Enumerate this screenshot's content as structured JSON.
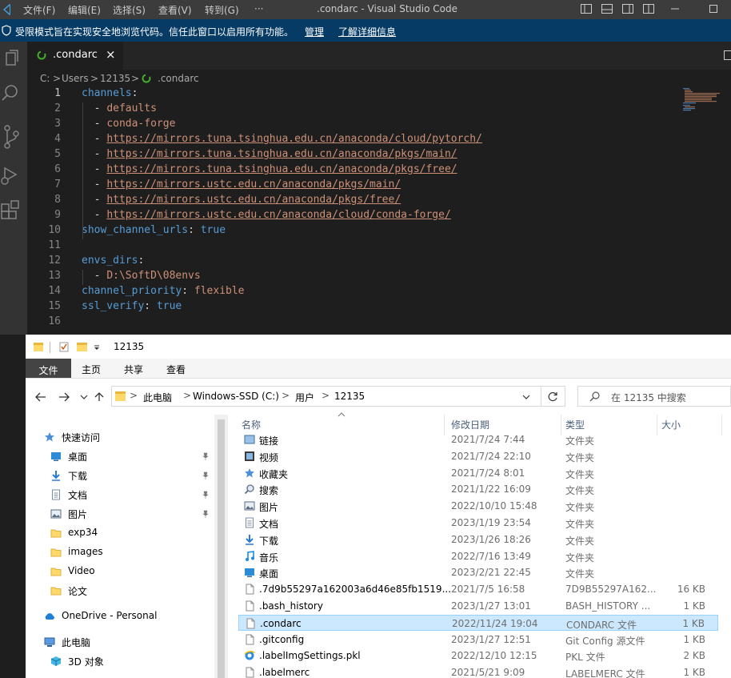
{
  "titlebar": {
    "menus": [
      "文件(F)",
      "编辑(E)",
      "选择(S)",
      "查看(V)",
      "转到(G)",
      "···"
    ],
    "title": ".condarc - Visual Studio Code"
  },
  "banner": {
    "text": "受限模式旨在实现安全地浏览代码。信任此窗口以启用所有功能。",
    "manage": "管理",
    "learn_more": "了解详细信息"
  },
  "tab": {
    "label": ".condarc",
    "close": "×"
  },
  "breadcrumb": [
    "C:",
    ">",
    "Users",
    ">",
    "12135",
    ">",
    ".condarc"
  ],
  "code": {
    "lines": [
      [
        [
          "key",
          "channels"
        ],
        [
          "dash",
          ":"
        ]
      ],
      [
        [
          "dash",
          "  - "
        ],
        [
          "str",
          "defaults"
        ]
      ],
      [
        [
          "dash",
          "  - "
        ],
        [
          "str",
          "conda-forge"
        ]
      ],
      [
        [
          "dash",
          "  - "
        ],
        [
          "url",
          "https://mirrors.tuna.tsinghua.edu.cn/anaconda/cloud/pytorch/"
        ]
      ],
      [
        [
          "dash",
          "  - "
        ],
        [
          "url",
          "https://mirrors.tuna.tsinghua.edu.cn/anaconda/pkgs/main/"
        ]
      ],
      [
        [
          "dash",
          "  - "
        ],
        [
          "url",
          "https://mirrors.tuna.tsinghua.edu.cn/anaconda/pkgs/free/"
        ]
      ],
      [
        [
          "dash",
          "  - "
        ],
        [
          "url",
          "https://mirrors.ustc.edu.cn/anaconda/pkgs/main/"
        ]
      ],
      [
        [
          "dash",
          "  - "
        ],
        [
          "url",
          "https://mirrors.ustc.edu.cn/anaconda/pkgs/free/"
        ]
      ],
      [
        [
          "dash",
          "  - "
        ],
        [
          "url",
          "https://mirrors.ustc.edu.cn/anaconda/cloud/conda-forge/"
        ]
      ],
      [
        [
          "key",
          "show_channel_urls"
        ],
        [
          "dash",
          ": "
        ],
        [
          "bool",
          "true"
        ]
      ],
      [],
      [
        [
          "key",
          "envs_dirs"
        ],
        [
          "dash",
          ":"
        ]
      ],
      [
        [
          "dash",
          "  - "
        ],
        [
          "str",
          "D:\\SoftD\\08envs"
        ]
      ],
      [
        [
          "key",
          "channel_priority"
        ],
        [
          "dash",
          ": "
        ],
        [
          "str",
          "flexible"
        ]
      ],
      [
        [
          "key",
          "ssl_verify"
        ],
        [
          "dash",
          ": "
        ],
        [
          "bool",
          "true"
        ]
      ],
      []
    ]
  },
  "explorer": {
    "qa_title": "12135",
    "ribbon": [
      "文件",
      "主页",
      "共享",
      "查看"
    ],
    "address": [
      "此电脑",
      ">",
      "Windows-SSD (C:)",
      ">",
      "用户",
      ">",
      "12135"
    ],
    "search_placeholder": "在 12135 中搜索",
    "nav": [
      {
        "label": "快速访问",
        "icon": "star",
        "indent": 0,
        "pin": false
      },
      {
        "label": "桌面",
        "icon": "desktop",
        "indent": 1,
        "pin": true
      },
      {
        "label": "下载",
        "icon": "download",
        "indent": 1,
        "pin": true
      },
      {
        "label": "文档",
        "icon": "doc",
        "indent": 1,
        "pin": true
      },
      {
        "label": "图片",
        "icon": "pic",
        "indent": 1,
        "pin": true
      },
      {
        "label": "exp34",
        "icon": "folder",
        "indent": 1,
        "pin": false
      },
      {
        "label": "images",
        "icon": "folder",
        "indent": 1,
        "pin": false
      },
      {
        "label": "Video",
        "icon": "folder",
        "indent": 1,
        "pin": false
      },
      {
        "label": "论文",
        "icon": "folder",
        "indent": 1,
        "pin": false
      },
      {
        "label": "OneDrive - Personal",
        "icon": "cloud",
        "indent": 0,
        "pin": false
      },
      {
        "label": "此电脑",
        "icon": "pc",
        "indent": 0,
        "pin": false
      },
      {
        "label": "3D 对象",
        "icon": "cube",
        "indent": 1,
        "pin": false
      }
    ],
    "columns": [
      "名称",
      "修改日期",
      "类型",
      "大小"
    ],
    "rows": [
      {
        "name": "链接",
        "date": "2021/7/24 7:44",
        "type": "文件夹",
        "size": "",
        "icon": "link"
      },
      {
        "name": "视频",
        "date": "2021/7/24 22:10",
        "type": "文件夹",
        "size": "",
        "icon": "video"
      },
      {
        "name": "收藏夹",
        "date": "2021/7/24 8:01",
        "type": "文件夹",
        "size": "",
        "icon": "star"
      },
      {
        "name": "搜索",
        "date": "2021/1/22 16:09",
        "type": "文件夹",
        "size": "",
        "icon": "search"
      },
      {
        "name": "图片",
        "date": "2022/10/10 15:48",
        "type": "文件夹",
        "size": "",
        "icon": "pic"
      },
      {
        "name": "文档",
        "date": "2023/1/19 23:54",
        "type": "文件夹",
        "size": "",
        "icon": "doc"
      },
      {
        "name": "下载",
        "date": "2023/1/26 18:26",
        "type": "文件夹",
        "size": "",
        "icon": "download"
      },
      {
        "name": "音乐",
        "date": "2022/7/16 13:49",
        "type": "文件夹",
        "size": "",
        "icon": "music"
      },
      {
        "name": "桌面",
        "date": "2023/2/21 22:45",
        "type": "文件夹",
        "size": "",
        "icon": "desktop"
      },
      {
        "name": ".7d9b55297a162003a6d46e85fb1519...",
        "date": "2021/7/5 16:58",
        "type": "7D9B55297A162...",
        "size": "16 KB",
        "icon": "file"
      },
      {
        "name": ".bash_history",
        "date": "2023/1/27 13:01",
        "type": "BASH_HISTORY ...",
        "size": "1 KB",
        "icon": "file"
      },
      {
        "name": ".condarc",
        "date": "2022/11/24 19:04",
        "type": "CONDARC 文件",
        "size": "1 KB",
        "icon": "file",
        "selected": true
      },
      {
        "name": ".gitconfig",
        "date": "2023/1/27 12:51",
        "type": "Git Config 源文件",
        "size": "1 KB",
        "icon": "file"
      },
      {
        "name": ".labelImgSettings.pkl",
        "date": "2022/12/10 12:15",
        "type": "PKL 文件",
        "size": "2 KB",
        "icon": "ie"
      },
      {
        "name": ".labelmerc",
        "date": "2021/5/21 9:09",
        "type": "LABELMERC 文件",
        "size": "1 KB",
        "icon": "file"
      }
    ]
  }
}
